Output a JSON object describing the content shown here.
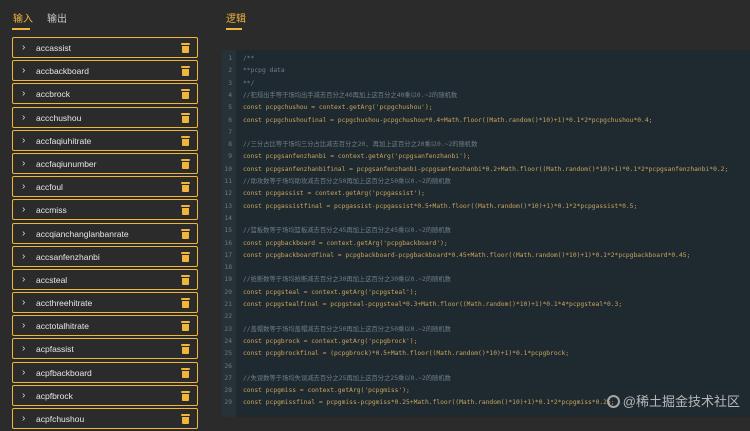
{
  "tabs": {
    "input": "输入",
    "output": "输出",
    "logic": "逻辑"
  },
  "items": [
    "accassist",
    "accbackboard",
    "accbrock",
    "accchushou",
    "accfaqiuhitrate",
    "accfaqiunumber",
    "accfoul",
    "accmiss",
    "accqianchanglanbanrate",
    "accsanfenzhanbi",
    "accsteal",
    "accthreehitrate",
    "acctotalhitrate",
    "acpfassist",
    "acpfbackboard",
    "acpfbrock",
    "acpfchushou"
  ],
  "code": [
    "/**",
    "**pcpg data",
    "**/",
    "//犯规出手等于场均出手减去百分之40再加上这百分之40乘以0.~2的随机数",
    "const pcpgchushou = context.getArg('pcpgchushou');",
    "const pcpgchushoufinal = pcpgchushou-pcpgchushou*0.4+Math.floor((Math.random()*10)+1)*0.1*2*pcpgchushou*0.4;",
    "",
    "//三分占比等于场均三分占比减去百分之20, 再加上这百分之20乘以0.~2的随机数",
    "const pcpgsanfenzhanbi = context.getArg('pcpgsanfenzhanbi');",
    "const pcpgsanfenzhanbifinal = pcpgsanfenzhanbi-pcpgsanfenzhanbi*0.2+Math.floor((Math.random()*10)+1)*0.1*2*pcpgsanfenzhanbi*0.2;",
    "//助攻数等于场均助攻减去百分之50再加上这百分之50乘以0.~2的随机数",
    "const pcpgassist = context.getArg('pcpgassist');",
    "const pcpgassistfinal = pcpgassist-pcpgassist*0.5+Math.floor((Math.random()*10)+1)*0.1*2*pcpgassist*0.5;",
    "",
    "//篮板数等于场均篮板减去百分之45再加上这百分之45乘以0.~2的随机数",
    "const pcpgbackboard = context.getArg('pcpgbackboard');",
    "const pcpgbackboardfinal = pcpgbackboard-pcpgbackboard*0.45+Math.floor((Math.random()*10)+1)*0.1*2*pcpgbackboard*0.45;",
    "",
    "//抢断数等于场均抢断减去百分之30再加上这百分之30乘以0.~2的随机数",
    "const pcpgsteal = context.getArg('pcpgsteal');",
    "const pcpgstealfinal = pcpgsteal-pcpgsteal*0.3+Math.floor((Math.random()*10)+1)*0.1*4*pcpgsteal*0.3;",
    "",
    "//盖帽数等于场均盖帽减去百分之50再加上这百分之50乘以0.~2的随机数",
    "const pcpgbrock = context.getArg('pcpgbrock');",
    "const pcpgbrockfinal = (pcpgbrock)*0.5+Math.floor((Math.random()*10)+1)*0.1*pcpgbrock;",
    "",
    "//失误数等于场均失误减去百分之25再加上这百分之25乘以0.~2的随机数",
    "const pcpgmiss = context.getArg('pcpgmiss');",
    "const pcpgmissfinal = pcpgmiss-pcpgmiss*0.25+Math.floor((Math.random()*10)+1)*0.1*2*pcpgmiss*0.25;"
  ],
  "watermark": "@稀土掘金技术社区"
}
